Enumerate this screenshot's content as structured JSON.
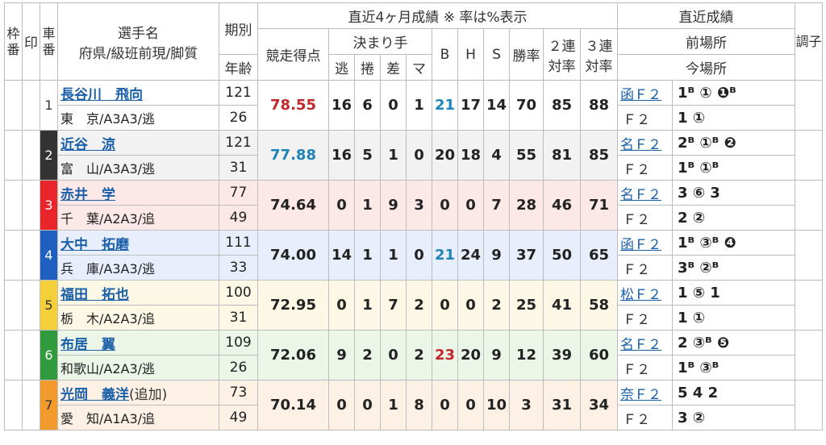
{
  "header": {
    "waku": "枠番",
    "mark": "印",
    "car": "車番",
    "name_line1": "選手名",
    "name_line2": "府県/級班前現/脚質",
    "term": "期別",
    "age": "年齢",
    "recent_title": "直近4ヶ月成績 ※ 率は%表示",
    "score": "競走得点",
    "kimarite": "決まり手",
    "nige": "逃",
    "makuri": "捲",
    "sashi": "差",
    "mark_k": "マ",
    "b": "B",
    "h": "H",
    "s": "S",
    "win": "勝率",
    "ren2_a": "２連",
    "ren2_b": "対率",
    "ren3_a": "３連",
    "ren3_b": "対率",
    "latest": "直近成績",
    "prev_venue": "前場所",
    "this_venue": "今場所",
    "cond": "調子"
  },
  "colors": {
    "accent_link": "#1a5fa8",
    "score_red": "#c0282d",
    "score_blue": "#1f83b5"
  },
  "riders": [
    {
      "car": "1",
      "name": "長谷川　飛向",
      "extra": "",
      "pref": "東　京/A3A3/逃",
      "term": "121",
      "age": "26",
      "score": "78.55",
      "nige": "16",
      "makuri": "6",
      "sashi": "0",
      "mark": "1",
      "b": "21",
      "h": "17",
      "s": "14",
      "win": "70",
      "ren2": "85",
      "ren3": "88",
      "prev_venue": "函Ｆ２",
      "prev_res": "1ᴮ ① ❶ᴮ",
      "this_venue": "Ｆ２",
      "this_res": "1 ①",
      "bg": "#ffffff",
      "wakuColor": "#ffffff",
      "wakuText": "#333",
      "scoreColor": "red",
      "bColor": "blue"
    },
    {
      "car": "2",
      "name": "近谷　涼",
      "extra": "",
      "pref": "富　山/A3A3/逃",
      "term": "121",
      "age": "31",
      "score": "77.88",
      "nige": "16",
      "makuri": "5",
      "sashi": "1",
      "mark": "0",
      "b": "20",
      "h": "18",
      "s": "4",
      "win": "55",
      "ren2": "81",
      "ren3": "85",
      "prev_venue": "名Ｆ２",
      "prev_res": "2ᴮ ①ᴮ ❷",
      "this_venue": "Ｆ２",
      "this_res": "1ᴮ ①ᴮ",
      "bg": "#f2f2f2",
      "wakuColor": "#333333",
      "wakuText": "#fff",
      "scoreColor": "blue",
      "bColor": ""
    },
    {
      "car": "3",
      "name": "赤井　学",
      "extra": "",
      "pref": "千　葉/A2A3/追",
      "term": "77",
      "age": "49",
      "score": "74.64",
      "nige": "0",
      "makuri": "1",
      "sashi": "9",
      "mark": "3",
      "b": "0",
      "h": "0",
      "s": "7",
      "win": "28",
      "ren2": "46",
      "ren3": "71",
      "prev_venue": "名Ｆ２",
      "prev_res": "3 ⑥ 3",
      "this_venue": "Ｆ２",
      "this_res": "2 ②",
      "bg": "#fde8e8",
      "wakuColor": "#e8252b",
      "wakuText": "#fff",
      "scoreColor": "",
      "bColor": ""
    },
    {
      "car": "4",
      "name": "大中　拓磨",
      "extra": "",
      "pref": "兵　庫/A3A3/逃",
      "term": "111",
      "age": "33",
      "score": "74.00",
      "nige": "14",
      "makuri": "1",
      "sashi": "1",
      "mark": "0",
      "b": "21",
      "h": "24",
      "s": "9",
      "win": "37",
      "ren2": "50",
      "ren3": "65",
      "prev_venue": "函Ｆ２",
      "prev_res": "1ᴮ ③ᴮ ❹",
      "this_venue": "Ｆ２",
      "this_res": "3ᴮ ②ᴮ",
      "bg": "#e8eefb",
      "wakuColor": "#1f5fbf",
      "wakuText": "#fff",
      "scoreColor": "",
      "bColor": "blue"
    },
    {
      "car": "5",
      "name": "福田　拓也",
      "extra": "",
      "pref": "栃　木/A2A3/追",
      "term": "100",
      "age": "31",
      "score": "72.95",
      "nige": "0",
      "makuri": "1",
      "sashi": "7",
      "mark": "2",
      "b": "0",
      "h": "0",
      "s": "2",
      "win": "25",
      "ren2": "41",
      "ren3": "58",
      "prev_venue": "松Ｆ２",
      "prev_res": "1 ⑤ 1",
      "this_venue": "Ｆ２",
      "this_res": "1 ①",
      "bg": "#fdf8e6",
      "wakuColor": "#f5cf3a",
      "wakuText": "#333",
      "scoreColor": "",
      "bColor": ""
    },
    {
      "car": "6",
      "name": "布居　翼",
      "extra": "",
      "pref": "和歌山/A2A3/逃",
      "term": "109",
      "age": "26",
      "score": "72.06",
      "nige": "9",
      "makuri": "2",
      "sashi": "0",
      "mark": "2",
      "b": "23",
      "h": "20",
      "s": "9",
      "win": "12",
      "ren2": "39",
      "ren3": "60",
      "prev_venue": "名Ｆ２",
      "prev_res": "2 ③ᴮ ❺",
      "this_venue": "Ｆ２",
      "this_res": "1ᴮ ③ᴮ",
      "bg": "#ebf6e8",
      "wakuColor": "#2f9b3c",
      "wakuText": "#fff",
      "scoreColor": "",
      "bColor": "red"
    },
    {
      "car": "7",
      "name": "光岡　義洋",
      "extra": "(追加)",
      "pref": "愛　知/A1A3/追",
      "term": "73",
      "age": "49",
      "score": "70.14",
      "nige": "0",
      "makuri": "0",
      "sashi": "1",
      "mark": "8",
      "b": "0",
      "h": "0",
      "s": "10",
      "win": "3",
      "ren2": "31",
      "ren3": "34",
      "prev_venue": "奈Ｆ２",
      "prev_res": "5 4 2",
      "this_venue": "Ｆ２",
      "this_res": "3 ②",
      "bg": "#fdf0e4",
      "wakuColor": "#f39a2c",
      "wakuText": "#333",
      "scoreColor": "",
      "bColor": ""
    }
  ]
}
